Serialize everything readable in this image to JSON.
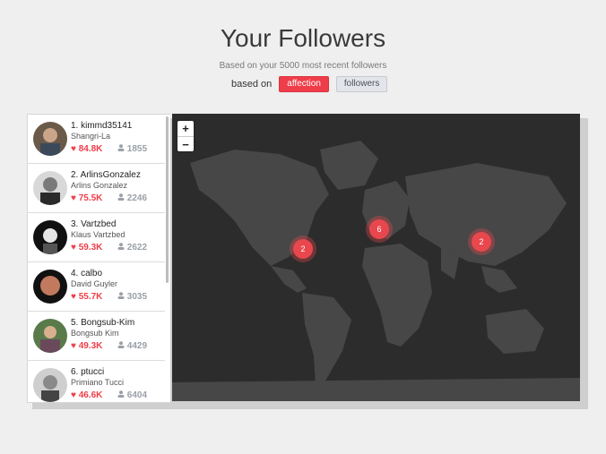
{
  "header": {
    "title": "Your Followers",
    "subtitle": "Based on your 5000 most recent followers",
    "based_on_label": "based on",
    "btn_affection": "affection",
    "btn_followers": "followers"
  },
  "colors": {
    "accent": "#ef3e4a",
    "map_bg": "#2c2c2c",
    "land": "#4a4a4a"
  },
  "followers": [
    {
      "rank_name": "1. kimmd35141",
      "full": "Shangri-La",
      "likes": "84.8K",
      "followers": "1855"
    },
    {
      "rank_name": "2. ArlinsGonzalez",
      "full": "Arlins Gonzalez",
      "likes": "75.5K",
      "followers": "2246"
    },
    {
      "rank_name": "3. Vartzbed",
      "full": "Klaus Vartzbed",
      "likes": "59.3K",
      "followers": "2622"
    },
    {
      "rank_name": "4. calbo",
      "full": "David Guyler",
      "likes": "55.7K",
      "followers": "3035"
    },
    {
      "rank_name": "5. Bongsub-Kim",
      "full": "Bongsub Kim",
      "likes": "49.3K",
      "followers": "4429"
    },
    {
      "rank_name": "6. ptucci",
      "full": "Primiano Tucci",
      "likes": "46.6K",
      "followers": "6404"
    }
  ],
  "map": {
    "zoom_in": "+",
    "zoom_out": "−",
    "clusters": [
      "2",
      "6",
      "2"
    ]
  },
  "icons": {
    "heart": "heart-icon",
    "person": "person-icon"
  }
}
